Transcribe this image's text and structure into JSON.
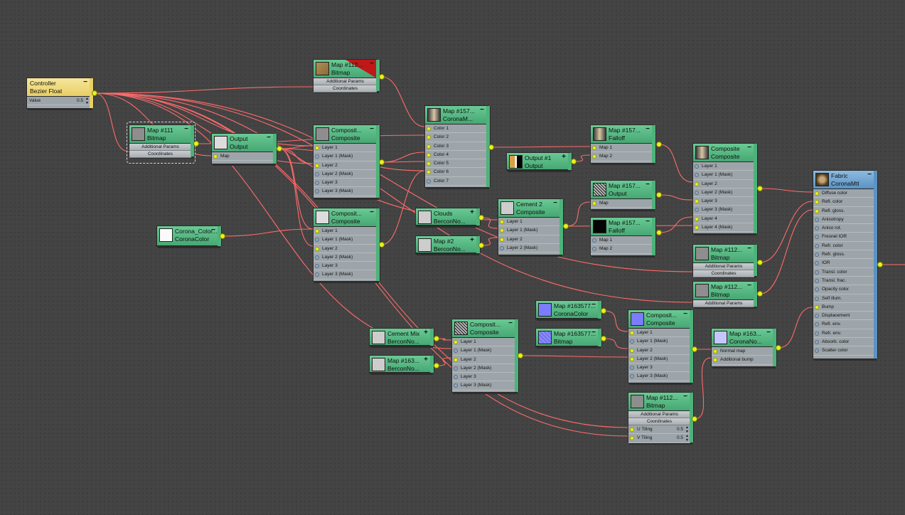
{
  "colors": {
    "background": "#444444",
    "wire": "#ff6a6a",
    "socket_on": "#e8f21a",
    "node_green": "#56b884",
    "node_yellow": "#f0d878",
    "node_blue": "#6fa3d2",
    "node_body": "#9da5aa"
  },
  "nodes": {
    "controller": {
      "title": "Controller",
      "type": "Bezier Float",
      "value_label": "Value",
      "value": "0.5",
      "ctl": "−"
    },
    "map112a": {
      "title": "Map #112...",
      "type": "Bitmap",
      "params": "Additional Params",
      "coords": "Coordinates",
      "ctl": "−"
    },
    "map111": {
      "title": "Map #111",
      "type": "Bitmap",
      "params": "Additional Params",
      "coords": "Coordinates",
      "ctl": "−"
    },
    "output1": {
      "title": "Output",
      "type": "Output",
      "slots": [
        "Map"
      ],
      "ctl": "−"
    },
    "comp1": {
      "title": "Composit...",
      "type": "Composite",
      "slots": [
        "Layer 1",
        "Layer 1 (Mask)",
        "Layer 2",
        "Layer 2 (Mask)",
        "Layer 3",
        "Layer 3 (Mask)"
      ],
      "ctl": "−"
    },
    "comp2": {
      "title": "Composit...",
      "type": "Composite",
      "slots": [
        "Layer 1",
        "Layer 1 (Mask)",
        "Layer 2",
        "Layer 2 (Mask)",
        "Layer 3",
        "Layer 3 (Mask)"
      ],
      "ctl": "−"
    },
    "coronaColor": {
      "title": "Corona_Color...",
      "type": "CoronaColor",
      "ctl": "−"
    },
    "map157m": {
      "title": "Map #157...",
      "type": "CoronaM...",
      "slots": [
        "Color 1",
        "Color 2",
        "Color 3",
        "Color 4",
        "Color 5",
        "Color 6",
        "Color 7"
      ],
      "ctl": "−"
    },
    "clouds": {
      "title": "Clouds",
      "type": "BerconNo...",
      "ctl": "+"
    },
    "map2": {
      "title": "Map #2",
      "type": "BerconNo...",
      "ctl": "+"
    },
    "output2": {
      "title": "Output #1",
      "type": "Output",
      "ctl": "+"
    },
    "cement2": {
      "title": "Cement 2",
      "type": "Composite",
      "slots": [
        "Layer 1",
        "Layer 1 (Mask)",
        "Layer 2",
        "Layer 2 (Mask)"
      ],
      "ctl": "−"
    },
    "fall1": {
      "title": "Map #157...",
      "type": "Falloff",
      "slots": [
        "Map 1",
        "Map 2"
      ],
      "ctl": "−"
    },
    "out157": {
      "title": "Map #157...",
      "type": "Output",
      "slots": [
        "Map"
      ],
      "ctl": "−"
    },
    "fall2": {
      "title": "Map #157...",
      "type": "Falloff",
      "slots": [
        "Map 1",
        "Map 2"
      ],
      "ctl": "−"
    },
    "comp3": {
      "title": "Composite",
      "type": "Composite",
      "slots": [
        "Layer 1",
        "Layer 1 (Mask)",
        "Layer 2",
        "Layer 2 (Mask)",
        "Layer 3",
        "Layer 3 (Mask)",
        "Layer 4",
        "Layer 4 (Mask)"
      ],
      "ctl": "−"
    },
    "map112b": {
      "title": "Map #112...",
      "type": "Bitmap",
      "params": "Additional Params",
      "coords": "Coordinates",
      "ctl": "−"
    },
    "map112c": {
      "title": "Map #112...",
      "type": "Bitmap",
      "params": "Additional Params",
      "ctl": "−"
    },
    "fabric": {
      "title": "Fabric",
      "type": "CoronaMtl",
      "slots": [
        "Diffuse color",
        "Refl. color",
        "Refl. gloss.",
        "Anisotropy",
        "Aniso rot.",
        "Fresnel IOR",
        "Refr. color",
        "Refr. gloss.",
        "IOR",
        "Transl. color",
        "Transl. frac.",
        "Opacity color",
        "Self illum.",
        "Bump",
        "Displacement",
        "Refl. env.",
        "Refr. env.",
        "Absorb. color",
        "Scatter color"
      ],
      "ctl": "−"
    },
    "cementMix": {
      "title": "Cement Mix",
      "type": "BerconNo...",
      "ctl": "+"
    },
    "map163b": {
      "title": "Map #163...",
      "type": "BerconNo...",
      "ctl": "+"
    },
    "comp4": {
      "title": "Composit...",
      "type": "Composite",
      "slots": [
        "Layer 1",
        "Layer 1 (Mask)",
        "Layer 2",
        "Layer 2 (Mask)",
        "Layer 3",
        "Layer 3 (Mask)"
      ],
      "ctl": "−"
    },
    "cc163": {
      "title": "Map #163577...",
      "type": "CoronaColor",
      "ctl": "−"
    },
    "bm163": {
      "title": "Map #163577...",
      "type": "Bitmap",
      "ctl": "−"
    },
    "comp5": {
      "title": "Composit...",
      "type": "Composite",
      "slots": [
        "Layer 1",
        "Layer 1 (Mask)",
        "Layer 2",
        "Layer 2 (Mask)",
        "Layer 3",
        "Layer 3 (Mask)"
      ],
      "ctl": "−"
    },
    "normal163": {
      "title": "Map #163...",
      "type": "CoronaNo...",
      "slots": [
        "Normal map",
        "Additional bump"
      ],
      "ctl": "−"
    },
    "map112d": {
      "title": "Map #112...",
      "type": "Bitmap",
      "params": "Additional Params",
      "coords": "Coordinates",
      "slots": [
        {
          "label": "U Tiling",
          "value": "0.5"
        },
        {
          "label": "V Tiling",
          "value": "0.5"
        }
      ],
      "ctl": "−"
    }
  }
}
